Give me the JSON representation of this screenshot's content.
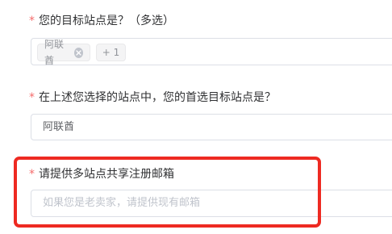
{
  "form": {
    "q1": {
      "required_mark": "*",
      "label": "您的目标站点是？（多选）",
      "selected_tag": "阿联酋",
      "more_tag": "+ 1"
    },
    "q2": {
      "required_mark": "*",
      "label": "在上述您选择的站点中，您的首选目标站点是？",
      "value": "阿联酋"
    },
    "q3": {
      "required_mark": "*",
      "label": "请提供多站点共享注册邮箱",
      "placeholder": "如果您是老卖家，请提供现有邮箱"
    }
  },
  "icons": {
    "tag_close": "close-circle-icon"
  },
  "colors": {
    "required": "#f56c6c",
    "highlight_border": "#ee2a22",
    "input_border": "#dcdfe6",
    "placeholder": "#c0c4cc"
  }
}
